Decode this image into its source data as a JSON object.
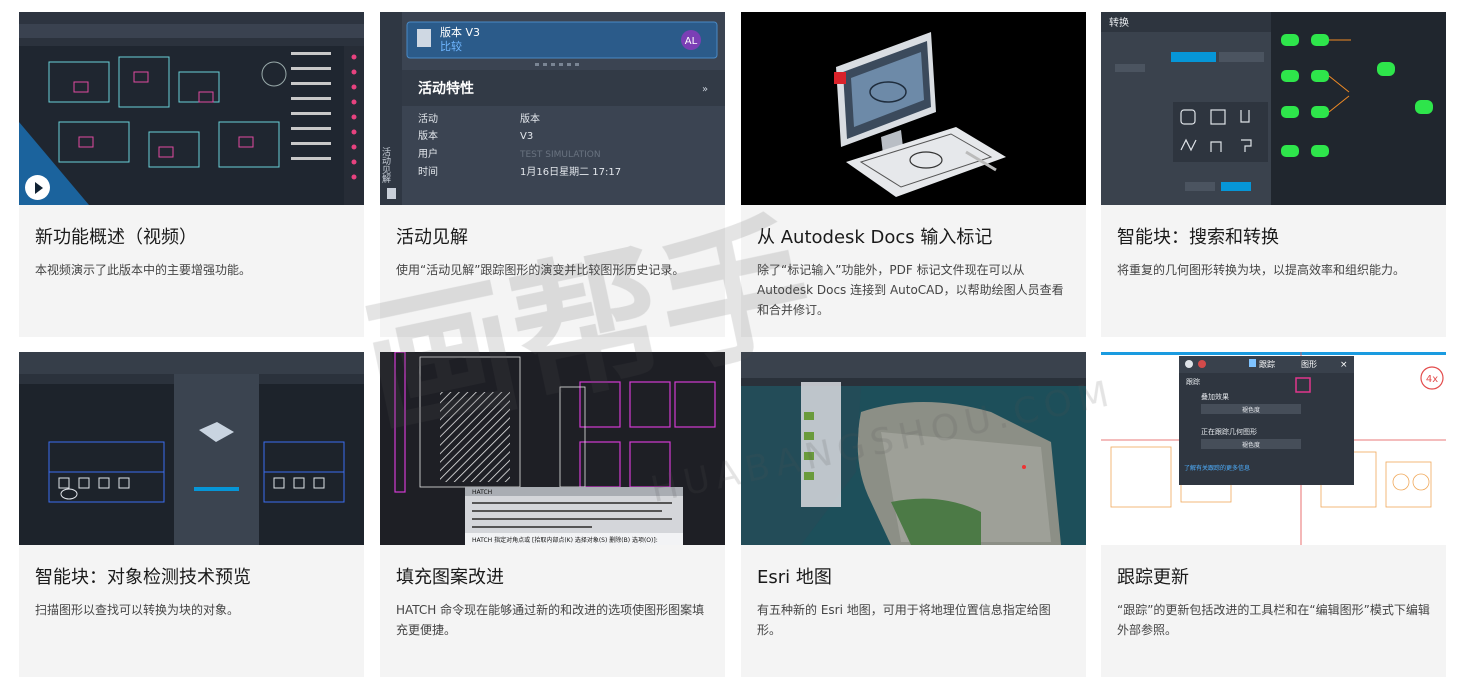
{
  "cards": [
    {
      "title": "新功能概述（视频）",
      "desc": "本视频演示了此版本中的主要增强功能。"
    },
    {
      "title": "活动见解",
      "desc": "使用“活动见解”跟踪图形的演变并比较图形历史记录。"
    },
    {
      "title": "从 Autodesk Docs 输入标记",
      "desc": "除了“标记输入”功能外，PDF 标记文件现在可以从 Autodesk Docs 连接到 AutoCAD，以帮助绘图人员查看和合并修订。"
    },
    {
      "title": "智能块：搜索和转换",
      "desc": "将重复的几何图形转换为块，以提高效率和组织能力。"
    },
    {
      "title": "智能块：对象检测技术预览",
      "desc": "扫描图形以查找可以转换为块的对象。"
    },
    {
      "title": "填充图案改进",
      "desc": "HATCH 命令现在能够通过新的和改进的选项使图形图案填充更便捷。"
    },
    {
      "title": "Esri 地图",
      "desc": "有五种新的 Esri 地图，可用于将地理位置信息指定给图形。"
    },
    {
      "title": "跟踪更新",
      "desc": "“跟踪”的更新包括改进的工具栏和在“编辑图形”模式下编辑外部参照。"
    }
  ],
  "activity_panel": {
    "version_label": "版本 V3",
    "compare_label": "比较",
    "avatar": "AL",
    "section_title": "活动特性",
    "rows": [
      {
        "k": "活动",
        "v": "版本"
      },
      {
        "k": "版本",
        "v": "V3"
      },
      {
        "k": "用户",
        "v": "TEST SIMULATION"
      },
      {
        "k": "时间",
        "v": "1月16日星期二 17:17"
      }
    ],
    "side_tab": "活动见解"
  },
  "convert_panel": {
    "title": "转换"
  },
  "trace_panel": {
    "tab_trace": "跟踪",
    "tab_figure": "图形",
    "section": "跟踪",
    "overlay": "叠加效果",
    "fade": "褪色度",
    "geometry": "正在跟踪几何图形",
    "link": "了解有关跟踪的更多信息",
    "zoom_badge": "4x"
  },
  "hatch_cmd": {
    "cmd": "HATCH",
    "prompt": "HATCH 指定对角点或 [拾取内部点(K) 选择对象(S) 删除(B) 选项(O)]:"
  },
  "colors": {
    "card_bg": "#f4f4f4",
    "title": "#1a1a1a",
    "desc": "#444444",
    "dark_ui": "#2b2f36",
    "accent": "#0696d7"
  },
  "watermark": {
    "brand": "画帮手",
    "url": "HUABANGSHOU.COM"
  }
}
